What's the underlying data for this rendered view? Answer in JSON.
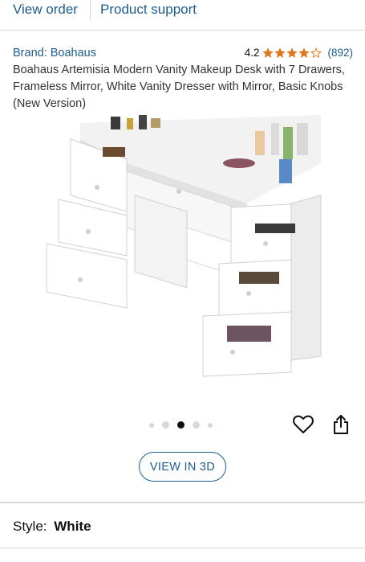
{
  "nav": {
    "view_order": "View order",
    "product_support": "Product support"
  },
  "product": {
    "brand": "Brand: Boahaus",
    "rating_value": "4.2",
    "rating_stars": 4.2,
    "rating_count": "(892)",
    "title": "Boahaus Artemisia Modern Vanity Makeup Desk with 7 Drawers, Frameless Mirror, White Vanity Dresser with Mirror, Basic Knobs (New Version)"
  },
  "gallery": {
    "image_count": 5,
    "active_index": 2,
    "view_3d_label": "VIEW IN 3D"
  },
  "style": {
    "label": "Style:",
    "value": "White"
  },
  "colors": {
    "link": "#1f5c8a",
    "star": "#de7921",
    "text": "#0f1111",
    "border": "#d5d9d9"
  }
}
